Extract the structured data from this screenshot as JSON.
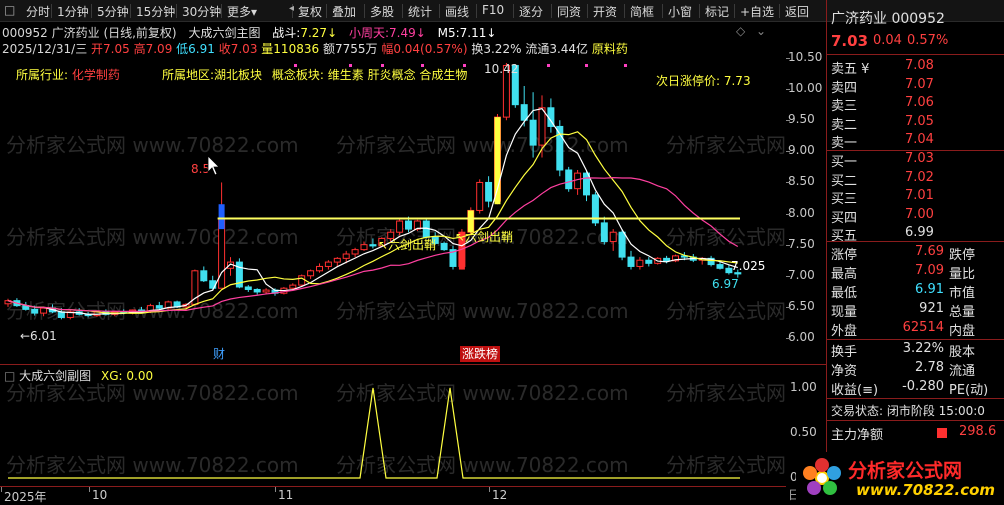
{
  "toolbar": {
    "items": [
      "分时",
      "1分钟",
      "5分钟",
      "15分钟",
      "30分钟",
      "更多",
      "复权",
      "叠加",
      "多股",
      "统计",
      "画线",
      "F10",
      "逐分",
      "同资",
      "开资",
      "简框",
      "小窗",
      "标记",
      "+自选",
      "返回"
    ],
    "more_arrow": "▾"
  },
  "chart_header": {
    "stock": "000952  广济药业 (日线,前复权)",
    "indicator": "大成六剑主图",
    "zhandou_label": "战斗:",
    "zhandou_value": "7.27",
    "xiaozhoutian_label": "小周天:",
    "xiaozhoutian_value": "7.49",
    "m5_label": "M5:",
    "m5_value": "7.11"
  },
  "info_line": {
    "date": "2025/12/31/三",
    "open": "开7.05",
    "high": "高7.09",
    "low": "低6.91",
    "close": "收7.03",
    "volume": "量110836",
    "amount": "额7755万",
    "amp": "幅0.04(0.57%)",
    "turnover": "换3.22%",
    "float": "流通3.44亿",
    "sector": "原料药"
  },
  "tags": {
    "industry_label": "所属行业:",
    "industry": "化学制药",
    "region_label": "所属地区:",
    "region": "湖北板块",
    "concept_label": "概念板块:",
    "concepts": "维生素 肝炎概念 合成生物"
  },
  "next_limit": "次日涨停价:  7.73",
  "annotations": {
    "high_mark": "10.42",
    "peak1": "8.5",
    "liujian1": "↖六剑出鞘",
    "liujian2": "↖六剑出鞘",
    "low_mark": "←6.01",
    "last_yellow": "7.025",
    "last_cyan": "6.97",
    "cai": "财",
    "zhangdiebang": "涨跌榜"
  },
  "main_axis": [
    "10.50",
    "10.00",
    "9.50",
    "9.00",
    "8.50",
    "8.00",
    "7.50",
    "7.00",
    "6.50",
    "6.00"
  ],
  "sub_header": {
    "name": "大成六剑副图",
    "xg_label": "XG:",
    "xg_value": "0.00"
  },
  "sub_axis": [
    "1.00",
    "0.50",
    "0.00"
  ],
  "time_axis": [
    "2025年",
    "10",
    "11",
    "12"
  ],
  "right_panel": {
    "title": "广济药业 000952",
    "price": "7.03",
    "change": "0.04",
    "pct": "0.57%",
    "asks": [
      {
        "label": "卖五 ¥",
        "price": "7.08"
      },
      {
        "label": "卖四",
        "price": "7.07"
      },
      {
        "label": "卖三",
        "price": "7.06"
      },
      {
        "label": "卖二",
        "price": "7.05"
      },
      {
        "label": "卖一",
        "price": "7.04"
      }
    ],
    "bids": [
      {
        "label": "买一",
        "price": "7.03"
      },
      {
        "label": "买二",
        "price": "7.02"
      },
      {
        "label": "买三",
        "price": "7.01"
      },
      {
        "label": "买四",
        "price": "7.00"
      },
      {
        "label": "买五",
        "price": "6.99"
      }
    ],
    "stats": [
      {
        "l1": "涨停",
        "v1": "7.69",
        "l2": "跌停"
      },
      {
        "l1": "最高",
        "v1": "7.09",
        "l2": "量比"
      },
      {
        "l1": "最低",
        "v1": "6.91",
        "l2": "市值"
      },
      {
        "l1": "现量",
        "v1": "921",
        "l2": "总量"
      },
      {
        "l1": "外盘",
        "v1": "62514",
        "l2": "内盘"
      }
    ],
    "stats2": [
      {
        "l1": "换手",
        "v1": "3.22%",
        "l2": "股本"
      },
      {
        "l1": "净资",
        "v1": "2.78",
        "l2": "流通"
      },
      {
        "l1": "收益(≡)",
        "v1": "-0.280",
        "l2": "PE(动)"
      }
    ],
    "trade_status": "交易状态: 闭市阶段 15:00:0",
    "main_net_label": "主力净额",
    "main_net_value": "298.6"
  },
  "watermark": "分析家公式网 www.70822.com",
  "logo": {
    "text": "分析家公式网",
    "url": "www.70822.com"
  },
  "colors": {
    "up": "#ff3030",
    "down": "#40e0f0",
    "yellow": "#ffff40",
    "ma_white": "#ffffff",
    "ma_pink": "#ff40a0",
    "bg": "#000000"
  }
}
